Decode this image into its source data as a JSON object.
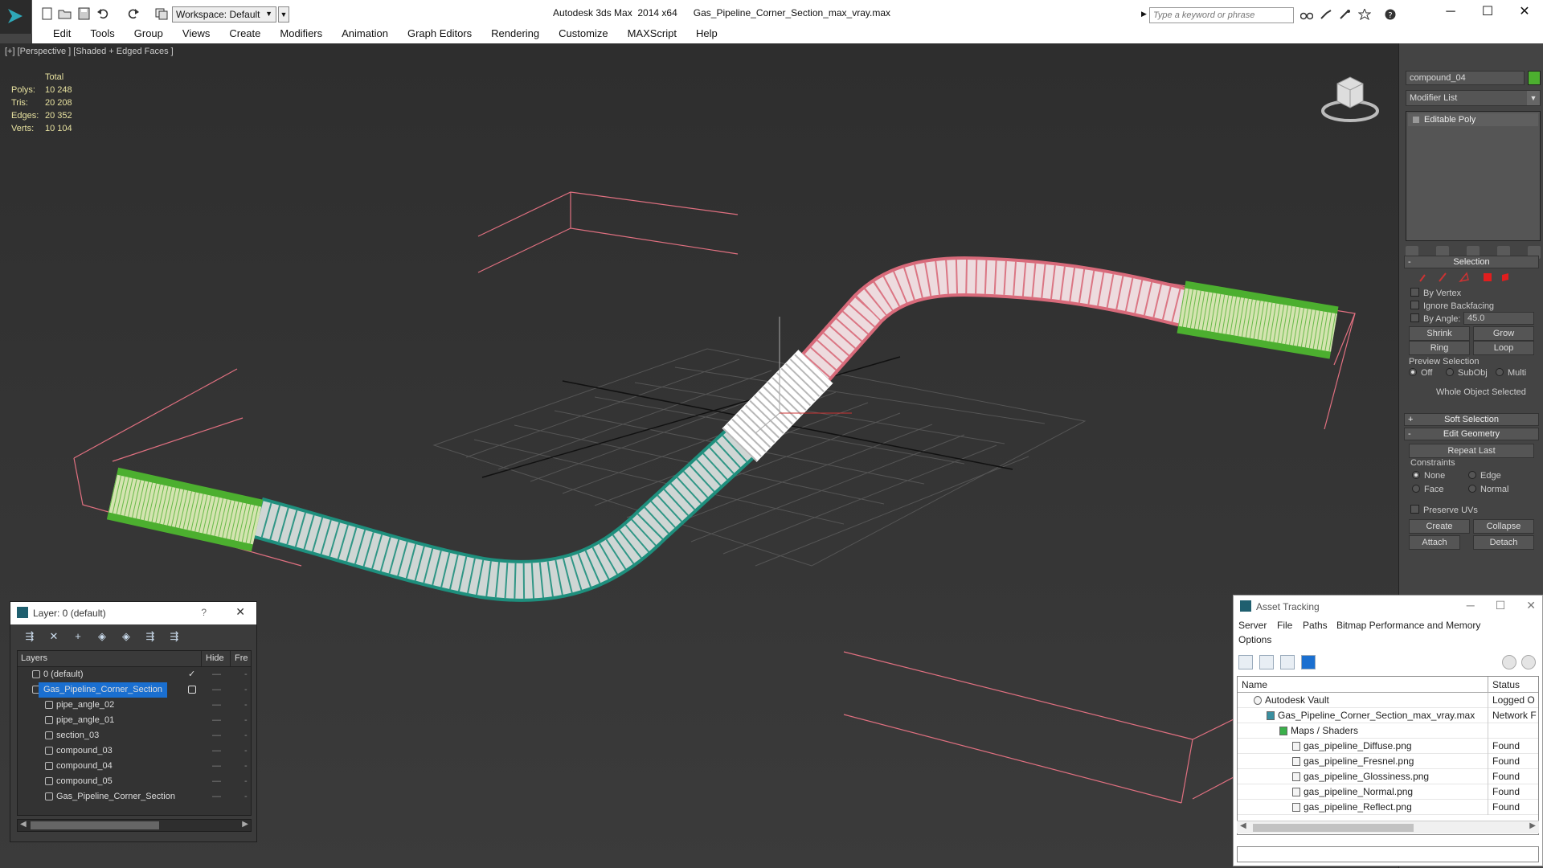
{
  "titlebar": {
    "workspace": "Workspace: Default",
    "title": "Autodesk 3ds Max  2014 x64      Gas_Pipeline_Corner_Section_max_vray.max",
    "search_placeholder": "Type a keyword or phrase",
    "minimize": "─",
    "maximize": "☐",
    "close": "✕"
  },
  "menu": [
    "Edit",
    "Tools",
    "Group",
    "Views",
    "Create",
    "Modifiers",
    "Animation",
    "Graph Editors",
    "Rendering",
    "Customize",
    "MAXScript",
    "Help"
  ],
  "viewport": {
    "label": "[+] [Perspective ] [Shaded + Edged Faces ]",
    "stats": {
      "header": "Total",
      "polys_label": "Polys:",
      "polys": "10 248",
      "tris_label": "Tris:",
      "tris": "20 208",
      "edges_label": "Edges:",
      "edges": "20 352",
      "verts_label": "Verts:",
      "verts": "10 104"
    }
  },
  "command_panel": {
    "object_name": "compound_04",
    "object_color": "#4caf2f",
    "modifier_list": "Modifier List",
    "stack": [
      "Editable Poly"
    ],
    "selection": {
      "title": "Selection",
      "by_vertex": "By Vertex",
      "ignore_backfacing": "Ignore Backfacing",
      "by_angle": "By Angle:",
      "angle_value": "45.0",
      "shrink": "Shrink",
      "grow": "Grow",
      "ring": "Ring",
      "loop": "Loop",
      "preview_selection": "Preview Selection",
      "off": "Off",
      "subobj": "SubObj",
      "multi": "Multi",
      "status": "Whole Object Selected"
    },
    "soft_selection": "Soft Selection",
    "edit_geometry": {
      "title": "Edit Geometry",
      "repeat_last": "Repeat Last",
      "constraints": "Constraints",
      "none": "None",
      "edge": "Edge",
      "face": "Face",
      "normal": "Normal",
      "preserve_uvs": "Preserve UVs",
      "create": "Create",
      "collapse": "Collapse",
      "attach": "Attach",
      "detach": "Detach"
    }
  },
  "layer_dialog": {
    "title": "Layer: 0 (default)",
    "help": "?",
    "close": "✕",
    "tools": [
      "⇶",
      "✕",
      "+",
      "◈",
      "◈",
      "⇶",
      "⇶"
    ],
    "col_layers": "Layers",
    "col_hide": "Hide",
    "col_freeze": "Fre",
    "rows": [
      {
        "name": "0 (default)",
        "level": 0,
        "check": "✓"
      },
      {
        "name": "Gas_Pipeline_Corner_Section",
        "level": 0,
        "selected": true
      },
      {
        "name": "pipe_angle_02",
        "level": 1
      },
      {
        "name": "pipe_angle_01",
        "level": 1
      },
      {
        "name": "section_03",
        "level": 1
      },
      {
        "name": "compound_03",
        "level": 1
      },
      {
        "name": "compound_04",
        "level": 1
      },
      {
        "name": "compound_05",
        "level": 1
      },
      {
        "name": "Gas_Pipeline_Corner_Section",
        "level": 1
      }
    ]
  },
  "asset_tracking": {
    "title": "Asset Tracking",
    "menu": [
      "Server",
      "File",
      "Paths",
      "Bitmap Performance and Memory",
      "Options"
    ],
    "col_name": "Name",
    "col_status": "Status",
    "rows": [
      {
        "name": "Autodesk Vault",
        "status": "Logged O",
        "level": 0
      },
      {
        "name": "Gas_Pipeline_Corner_Section_max_vray.max",
        "status": "Network F",
        "level": 1
      },
      {
        "name": "Maps / Shaders",
        "status": "",
        "level": 2
      },
      {
        "name": "gas_pipeline_Diffuse.png",
        "status": "Found",
        "level": 3
      },
      {
        "name": "gas_pipeline_Fresnel.png",
        "status": "Found",
        "level": 3
      },
      {
        "name": "gas_pipeline_Glossiness.png",
        "status": "Found",
        "level": 3
      },
      {
        "name": "gas_pipeline_Normal.png",
        "status": "Found",
        "level": 3
      },
      {
        "name": "gas_pipeline_Reflect.png",
        "status": "Found",
        "level": 3
      }
    ]
  }
}
